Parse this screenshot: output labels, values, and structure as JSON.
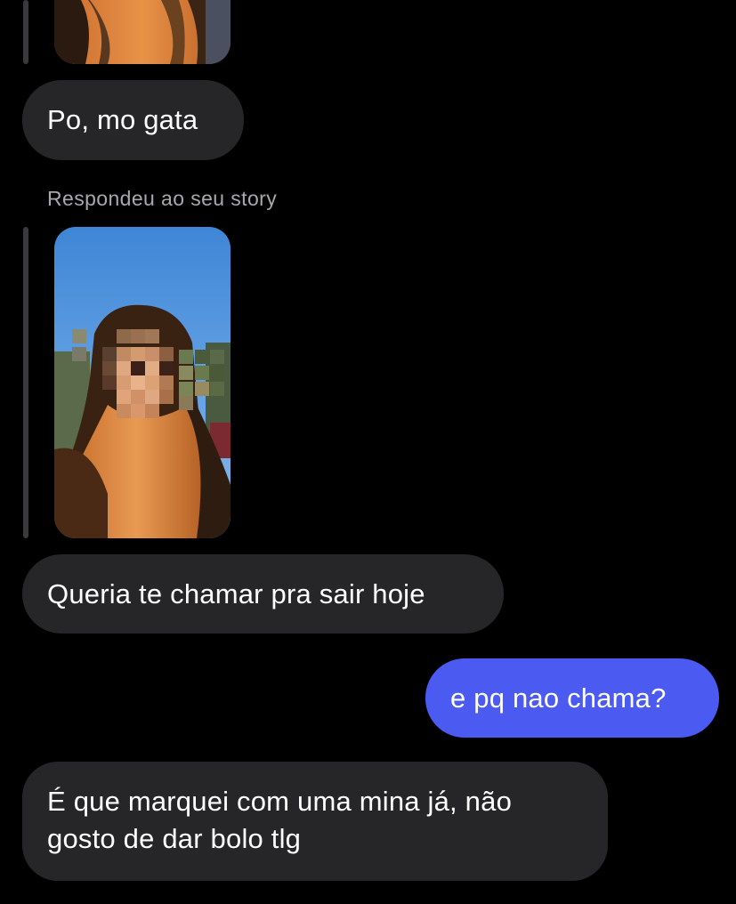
{
  "conversation": {
    "messages": [
      {
        "id": "m1",
        "direction": "received",
        "text": "Po, mo gata"
      },
      {
        "id": "m2",
        "direction": "received",
        "text": "Queria te chamar pra sair hoje"
      },
      {
        "id": "m3",
        "direction": "sent",
        "text": "e pq nao chama?"
      },
      {
        "id": "m4",
        "direction": "received",
        "lines": [
          "É que marquei com uma mina já, não",
          "gosto de dar bolo tlg"
        ]
      }
    ],
    "story_reply": {
      "label": "Respondeu ao seu story"
    }
  },
  "colors": {
    "background": "#000000",
    "received_bubble": "#262628",
    "sent_bubble": "#4b5af0",
    "reply_bar": "#3a3a3d",
    "secondary_text": "#a8a8ad"
  },
  "icons": {
    "story_thumbnail_top": "story-image",
    "story_thumbnail": "story-image"
  }
}
